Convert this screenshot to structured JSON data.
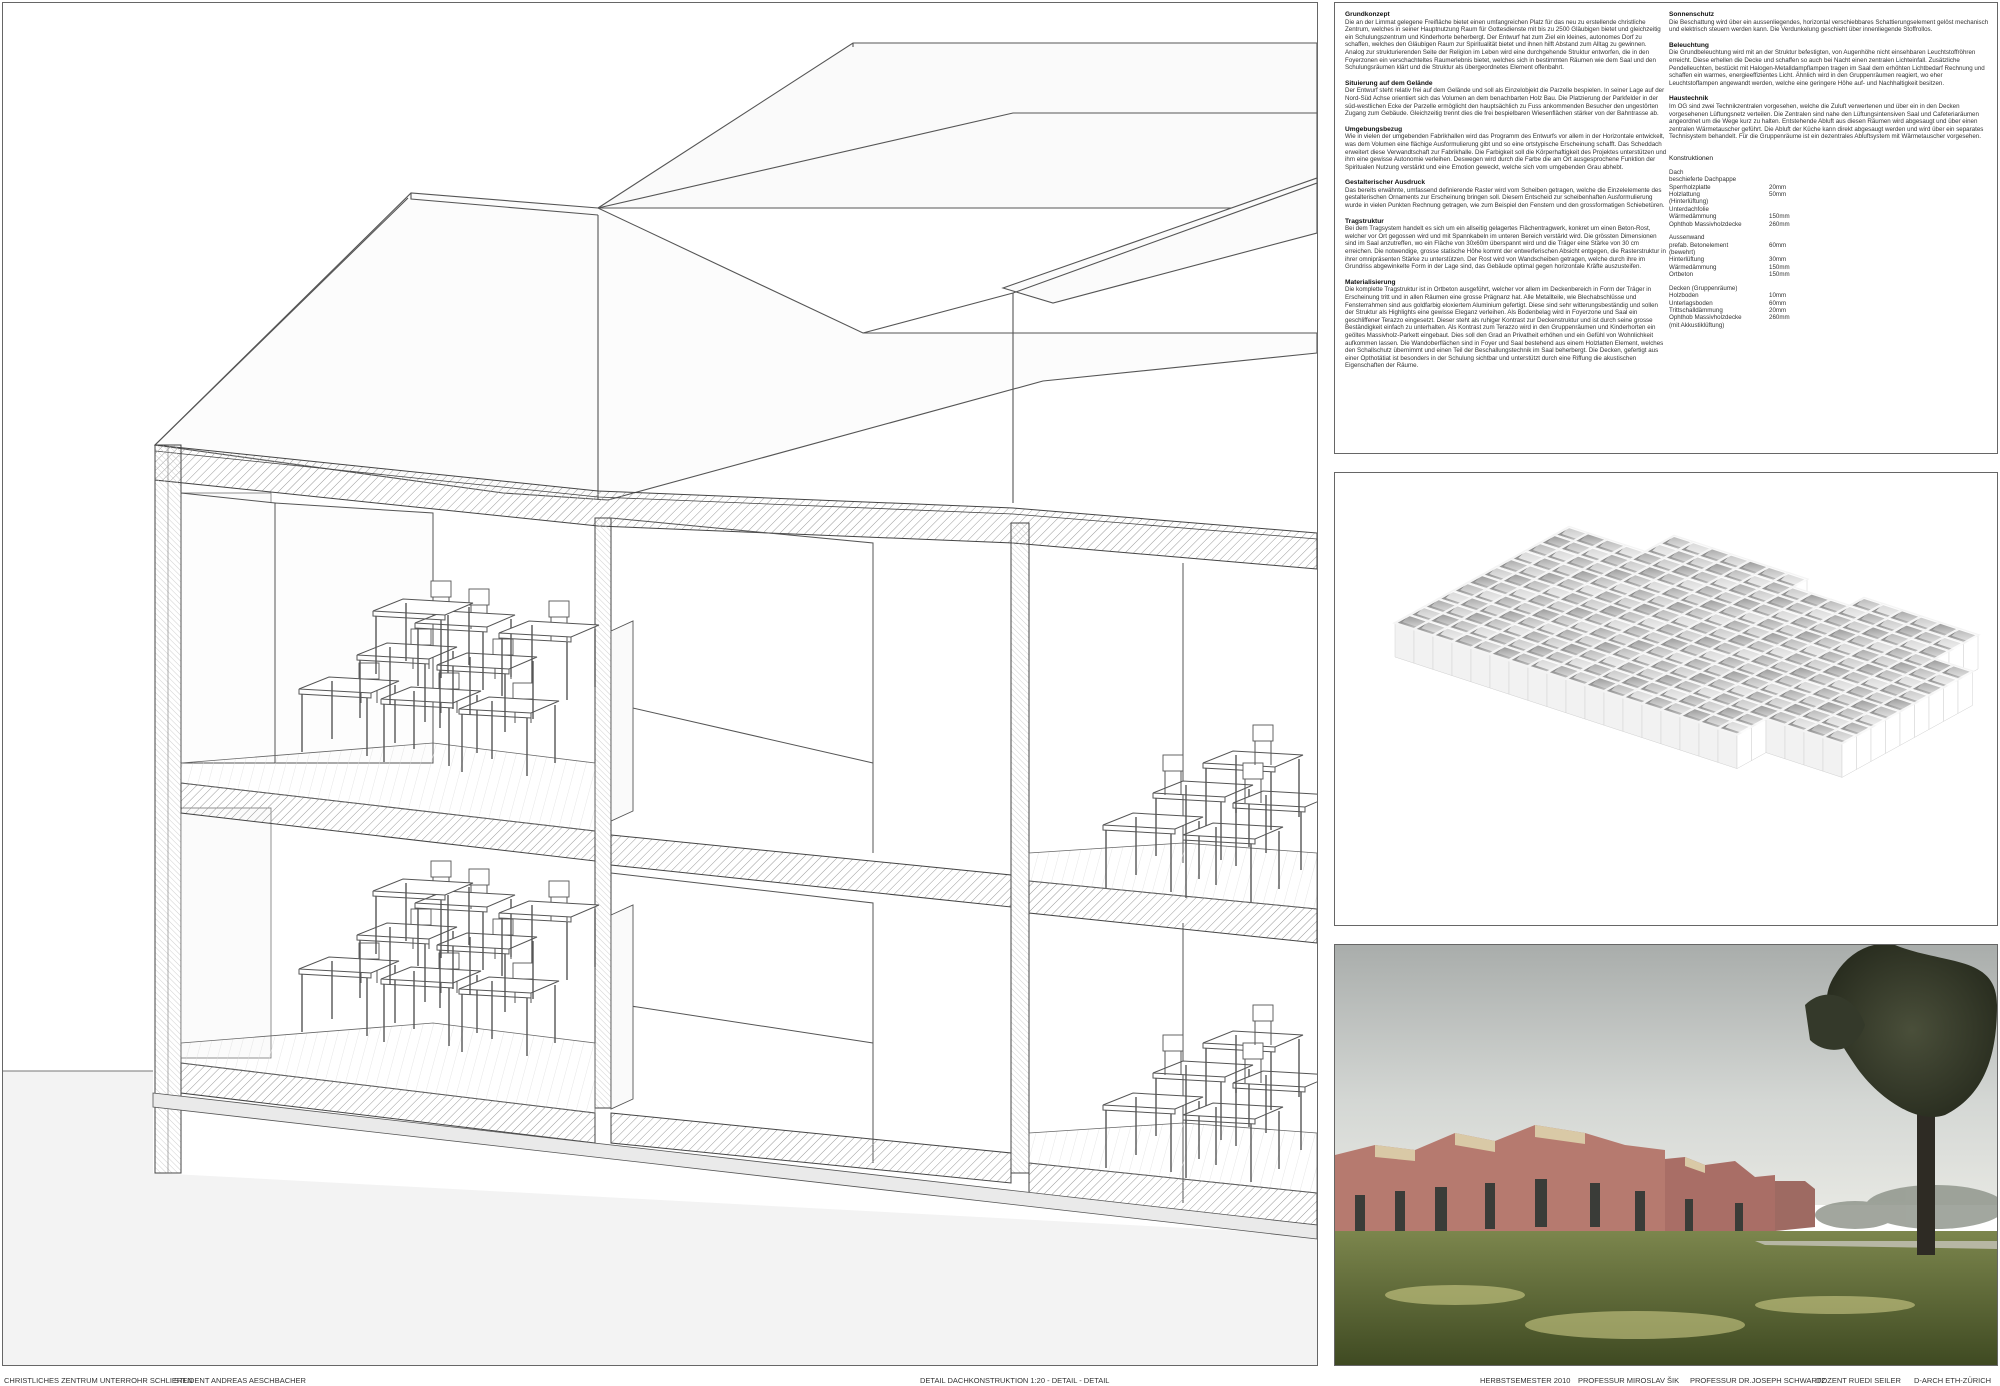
{
  "footer": {
    "project": "CHRISTLICHES ZENTRUM UNTERROHR SCHLIEREN",
    "student": "STUDENT ANDREAS AESCHBACHER",
    "detail": "DETAIL DACHKONSTRUKTION 1:20 - DETAIL - DETAIL",
    "semester": "HERBSTSEMESTER 2010",
    "prof1": "PROFESSUR MIROSLAV ŠIK",
    "prof2": "PROFESSUR DR.JOSEPH SCHWARTZ",
    "dozent": "DOZENT RUEDI SEILER",
    "institution": "D-ARCH ETH-ZÜRICH"
  },
  "text_left": [
    {
      "heading": "Grundkonzept",
      "body": "Die an der Limmat gelegene Freifläche bietet einen umfangreichen Platz für das neu zu erstellende christliche Zentrum, welches in seiner Hauptnutzung Raum für Gottesdienste mit bis zu 2500 Gläubigen bietet und gleichzeitig ein Schulungszentrum und Kinderhorte beherbergt. Der Entwurf hat zum Ziel ein kleines, autonomes Dorf zu schaffen, welches den Gläubigen Raum zur Spiritualität bietet und ihnen hilft Abstand zum Alltag zu gewinnen. Analog zur strukturierenden Seite der Religion im Leben wird eine durchgehende Struktur entworfen, die in den Foyerzonen ein verschachteltes Raumerlebnis bietet, welches sich in bestimmten Räumen wie dem Saal und den Schulungsräumen klärt und die Struktur als übergeordnetes Element offenbahrt."
    },
    {
      "heading": "Situierung auf dem Gelände",
      "body": "Der Entwurf steht relativ frei auf dem Gelände und soll als Einzelobjekt die Parzelle bespielen. In seiner Lage auf der Nord-Süd Achse orientiert sich das Volumen an dem benachbarten Holz Bau. Die Platzierung der Parkfelder in der süd-westlichen Ecke der Parzelle ermöglicht den hauptsächlich zu Fuss ankommenden Besucher den ungestörten Zugang zum Gebäude. Gleichzeitig trennt dies die frei bespielbaren Wiesenflächen stärker von der Bahntrasse ab."
    },
    {
      "heading": "Umgebungsbezug",
      "body": "Wie in vielen der umgebenden Fabrikhallen wird das Programm des Entwurfs vor allem in der Horizontale entwickelt, was dem Volumen eine flächige Ausformulierung gibt und so eine ortstypische Erscheinung schafft. Das Scheddach erweitert diese Verwandtschaft zur Fabrikhalle. Die Farbigkeit soll die Körperhaftigkeit des Projektes unterstützen und ihm eine gewisse Autonomie verleihen. Deswegen wird durch die Farbe die am Ort ausgesprochene Funktion der Spiritualen Nutzung verstärkt und eine Emotion geweckt, welche sich vom umgebenden Grau abhebt."
    },
    {
      "heading": "Gestalterischer Ausdruck",
      "body": "Das bereits erwähnte, umfassend definierende Raster wird vom Scheiben getragen, welche die Einzelelemente des gestalterischen Ornaments zur Erscheinung bringen soll. Diesem Entscheid zur scheibenhaften Ausformulierung wurde in vielen Punkten Rechnung getragen, wie zum Beispiel den Fenstern und den grossformatigen Schiebetüren."
    },
    {
      "heading": "Tragstruktur",
      "body": "Bei dem Tragsystem handelt es sich um ein allseitig gelagertes Flächentragwerk, konkret um einen Beton-Rost, welcher vor Ort gegossen wird und mit Spannkabeln im unteren Bereich verstärkt wird. Die grössten Dimensionen sind im Saal anzutreffen, wo ein Fläche von 30x60m überspannt wird und die Träger eine Stärke von 30 cm erreichen. Die notwendige, grosse statische Höhe kommt der entwerferischen Absicht entgegen, die Rasterstruktur in ihrer omnipräsenten Stärke zu unterstützen. Der Rost wird von Wandscheiben getragen, welche durch ihre im Grundriss abgewinkelte Form in der Lage sind, das Gebäude optimal gegen horizontale Kräfte auszusteifen."
    },
    {
      "heading": "Materialisierung",
      "body": "Die komplette Tragstruktur ist in Ortbeton ausgeführt, welcher vor allem im Deckenbereich in Form der Träger in Erscheinung tritt und in allen Räumen eine grosse Prägnanz hat. Alle Metallteile, wie Blechabschlüsse und Fensterrahmen sind aus goldfarbig eloxiertem Aluminium gefertigt. Diese sind sehr witterungsbeständig und sollen der Struktur als Highlights eine gewisse Eleganz verleihen. Als Bodenbelag wird in Foyerzone und Saal ein geschliffener Terazzo eingesetzt. Dieser steht als ruhiger Kontrast zur Deckenstruktur und ist durch seine grosse Beständigkeit einfach zu unterhalten. Als Kontrast zum Terazzo wird in den Gruppenräumen und Kinderhorten ein geöltes Massivholz-Parkett eingebaut. Dies soll den Grad an Privatheit erhöhen und ein Gefühl von Wohnlichkeit aufkommen lassen. Die Wandoberflächen sind in Foyer und Saal bestehend aus einem Holzlatten Element, welches den Schallschutz übernimmt und einen Teil der Beschallungstechnik im Saal beherbergt. Die Decken, gefertigt aus einer Opthotätiat ist besonders in der Schulung sichtbar und unterstützt durch eine Riffung die akustischen Eigenschaften der Räume."
    }
  ],
  "text_right": [
    {
      "heading": "Sonnenschutz",
      "body": "Die Beschattung wird über ein aussenliegendes, horizontal verschiebbares Schattierungselement gelöst mechanisch und elektrisch steuern werden kann. Die Verdunkelung geschieht über innenliegende Stoffrollos."
    },
    {
      "heading": "Beleuchtung",
      "body": "Die Grundbeleuchtung wird mit an der Struktur befestigten, von Augenhöhe nicht einsehbaren Leuchtstoffröhren erreicht. Diese erhellen die Decke und schaffen so auch bei Nacht einen zentralen Lichteinfall. Zusätzliche Pendelleuchten, bestückt mit Halogen-Metalldampflampen tragen im Saal dem erhöhten Lichtbedarf Rechnung und schaffen ein warmes, energieeffizientes Licht. Ähnlich wird in den Gruppenräumen reagiert, wo eher Leuchtstoffampen angewandt werden, welche eine geringere Höhe auf- und Nachhaltigkeit besitzen."
    },
    {
      "heading": "Haustechnik",
      "body": "Im OG sind zwei Technikzentralen vorgesehen, welche die Zuluft verwertenen und über ein in den Decken vorgesehenen Lüftungsnetz verteilen. Die Zentralen sind nahe den Lüftungsintensiven Saal und Cafeteriaräumen angeordnet um die Wege kurz zu halten. Entstehende Abluft aus diesen Räumen wird abgesaugt und über einen zentralen Wärmetauscher geführt. Die Abluft der Küche kann direkt abgesaugt werden und wird über ein separates Technisystem behandelt. Für die Gruppenräume ist ein dezentrales Abluftsystem mit Wärmetauscher vorgesehen."
    }
  ],
  "constructions": {
    "title": "Konstruktionen",
    "groups": [
      {
        "name": "Dach",
        "rows": [
          [
            "beschieferte Dachpappe",
            ""
          ],
          [
            "Sperrholzplatte",
            "20mm"
          ],
          [
            "Holzlattung",
            "50mm"
          ],
          [
            "(Hinterlüftung)",
            ""
          ],
          [
            "Unterdachfolie",
            ""
          ],
          [
            "Wärmedämmung",
            "150mm"
          ],
          [
            "Ophthob Massivholzdecke",
            "260mm"
          ]
        ]
      },
      {
        "name": "Aussenwand",
        "rows": [
          [
            "prefab. Betonelement",
            "60mm"
          ],
          [
            "(bewehrt)",
            ""
          ],
          [
            "Hinterlüftung",
            "30mm"
          ],
          [
            "Wärmedämmung",
            "150mm"
          ],
          [
            "Ortbeton",
            "150mm"
          ]
        ]
      },
      {
        "name": "Decken (Gruppenräume)",
        "rows": [
          [
            "Holzboden",
            "10mm"
          ],
          [
            "Unterlagsboden",
            "60mm"
          ],
          [
            "Trittschalldämmung",
            "20mm"
          ],
          [
            "Ophthob Massivholzdecke",
            "260mm"
          ],
          [
            "(mit Akkustiklüftung)",
            ""
          ]
        ]
      }
    ]
  },
  "colors": {
    "line": "#444444",
    "hatch": "#bbbbbb",
    "facade": "#b4736b",
    "grass": "#5d6a34",
    "sky": "#c9ccca"
  }
}
